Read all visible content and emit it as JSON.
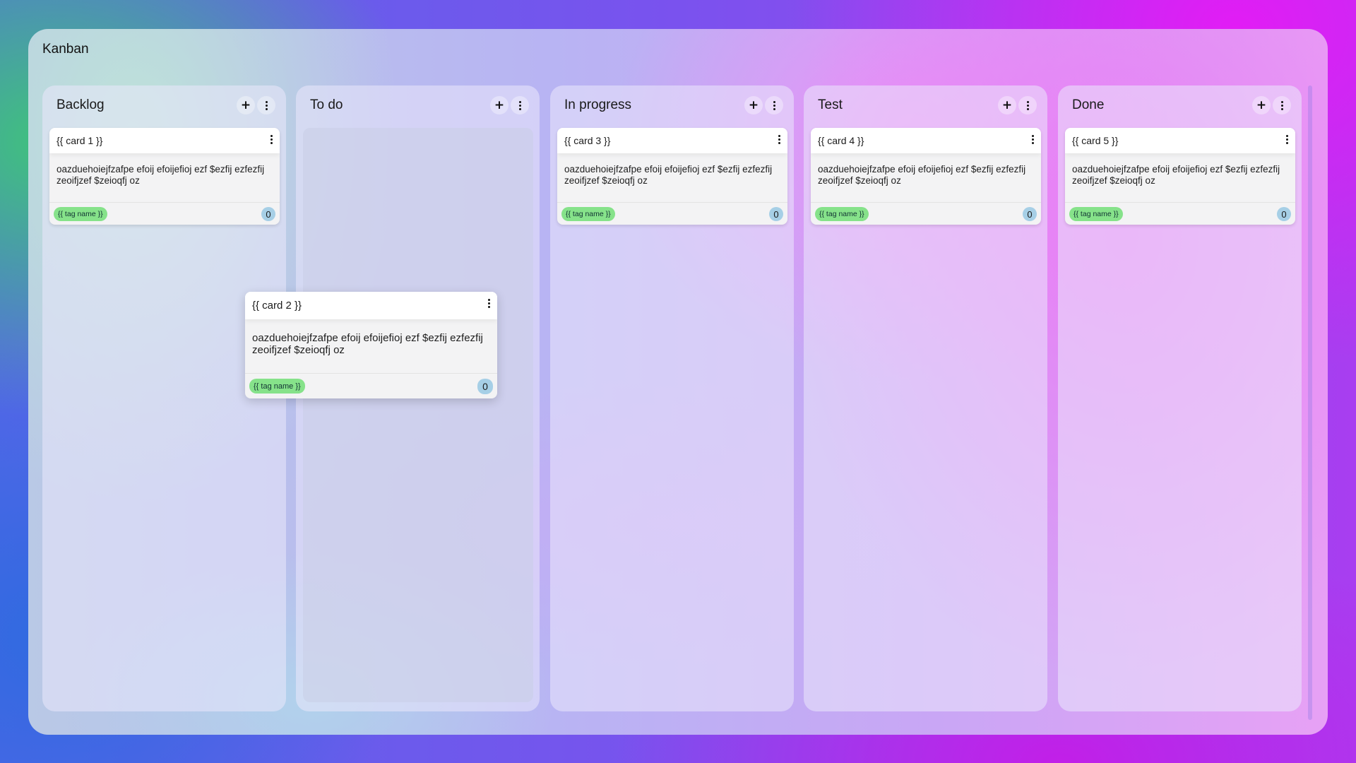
{
  "board": {
    "title": "Kanban"
  },
  "columns": [
    {
      "title": "Backlog",
      "add_label": "+",
      "cards": [
        {
          "title": "{{ card 1 }}",
          "body": "oazduehoiejfzafpe efoij efoijefioj ezf $ezfij ezfezfij zeoifjzef $zeioqfj oz",
          "tag": "{{ tag name }}",
          "count": "0"
        }
      ]
    },
    {
      "title": "To do",
      "add_label": "+",
      "cards": []
    },
    {
      "title": "In progress",
      "add_label": "+",
      "cards": [
        {
          "title": "{{ card 3 }}",
          "body": "oazduehoiejfzafpe efoij efoijefioj ezf $ezfij ezfezfij zeoifjzef $zeioqfj oz",
          "tag": "{{ tag name }}",
          "count": "0"
        }
      ]
    },
    {
      "title": "Test",
      "add_label": "+",
      "cards": [
        {
          "title": "{{ card 4 }}",
          "body": "oazduehoiejfzafpe efoij efoijefioj ezf $ezfij ezfezfij zeoifjzef $zeioqfj oz",
          "tag": "{{ tag name }}",
          "count": "0"
        }
      ]
    },
    {
      "title": "Done",
      "add_label": "+",
      "cards": [
        {
          "title": "{{ card 5 }}",
          "body": "oazduehoiejfzafpe efoij efoijefioj ezf $ezfij ezfezfij zeoifjzef $zeioqfj oz",
          "tag": "{{ tag name }}",
          "count": "0"
        }
      ]
    }
  ],
  "dragging_card": {
    "title": "{{ card 2 }}",
    "body": "oazduehoiejfzafpe efoij efoijefioj ezf $ezfij ezfezfij zeoifjzef $zeioqfj oz",
    "tag": "{{ tag name }}",
    "count": "0"
  },
  "icons": {
    "add": "plus-icon",
    "menu": "vertical-dots-icon"
  },
  "colors": {
    "tag": "#86e28a",
    "count_badge": "#a6cfe6",
    "card_header": "#ffffff",
    "card_body": "#f3f3f4"
  }
}
